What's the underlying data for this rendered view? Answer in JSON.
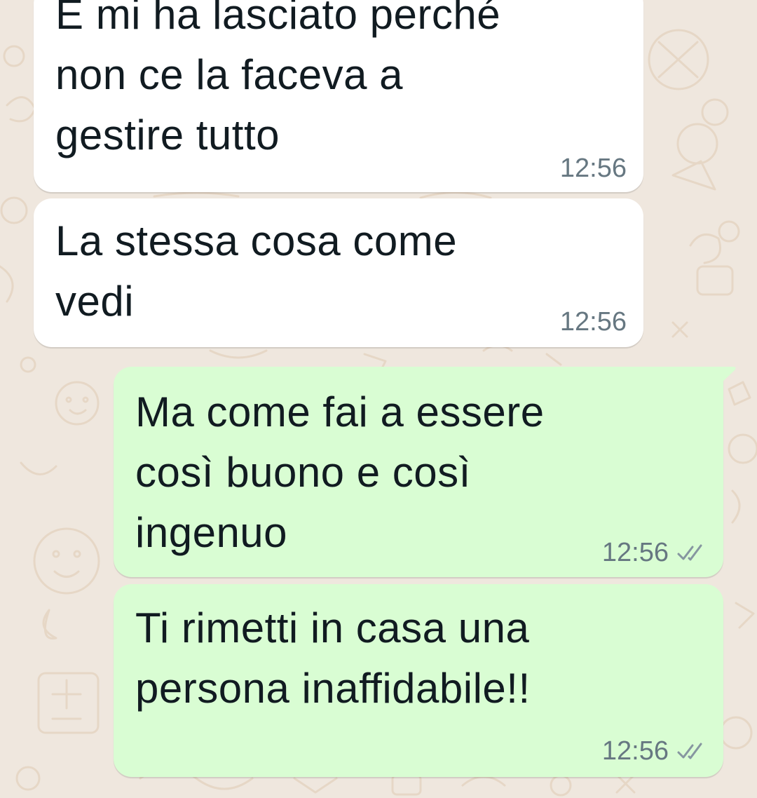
{
  "chat": {
    "messages": [
      {
        "direction": "incoming",
        "text": "E mi ha lasciato perché\nnon ce la faceva a\ngestire tutto",
        "time": "12:56"
      },
      {
        "direction": "incoming",
        "text": "La stessa cosa come\nvedi",
        "time": "12:56"
      },
      {
        "direction": "outgoing",
        "text": "Ma come fai a essere\ncosì buono e così\ningenuo",
        "time": "12:56",
        "status_icon": "double-check-icon"
      },
      {
        "direction": "outgoing",
        "text": "Ti rimetti in casa una\npersona inaffidabile!!",
        "time": "12:56",
        "status_icon": "double-check-icon"
      }
    ]
  },
  "colors": {
    "background": "#efe7de",
    "incoming_bubble": "#ffffff",
    "outgoing_bubble": "#d9fdd3",
    "text": "#111b21",
    "meta_text": "#667781"
  }
}
